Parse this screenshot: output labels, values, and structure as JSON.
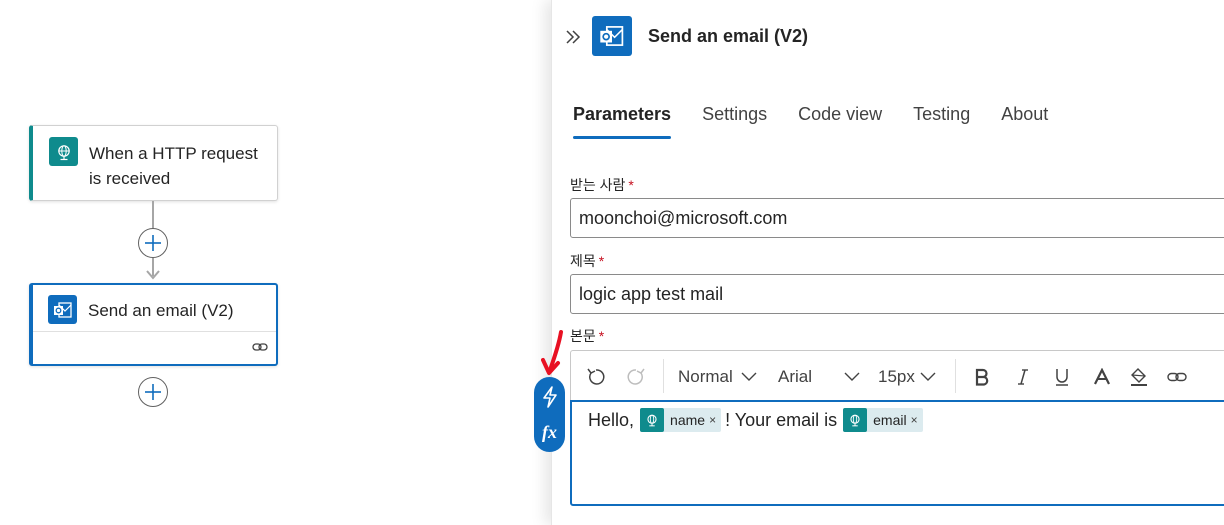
{
  "canvas": {
    "trigger": {
      "title": "When a HTTP request is received",
      "icon": "http-globe-icon",
      "accent": "#0f8b8d"
    },
    "action": {
      "title": "Send an email (V2)",
      "icon": "outlook-icon",
      "accent": "#0f6cbd"
    }
  },
  "panel": {
    "title": "Send an email (V2)",
    "icon": "outlook-icon",
    "tabs": [
      {
        "label": "Parameters",
        "active": true
      },
      {
        "label": "Settings",
        "active": false
      },
      {
        "label": "Code view",
        "active": false
      },
      {
        "label": "Testing",
        "active": false
      },
      {
        "label": "About",
        "active": false
      }
    ],
    "fields": {
      "to": {
        "label": "받는 사람",
        "required": "*",
        "value": "moonchoi@microsoft.com"
      },
      "subject": {
        "label": "제목",
        "required": "*",
        "value": "logic app test mail"
      },
      "body": {
        "label": "본문",
        "required": "*",
        "text_before": "Hello,",
        "token1": "name",
        "text_middle": "! Your email is",
        "token2": "email",
        "token_remove": "×"
      }
    },
    "toolbar": {
      "format": "Normal",
      "font": "Arial",
      "size": "15px"
    },
    "expression_label": "fx"
  },
  "colors": {
    "primary": "#0f6cbd",
    "trigger_teal": "#0f8b8d",
    "token_bg": "#dcebef",
    "required": "#c50f1f",
    "annotation_arrow": "#e81123"
  }
}
